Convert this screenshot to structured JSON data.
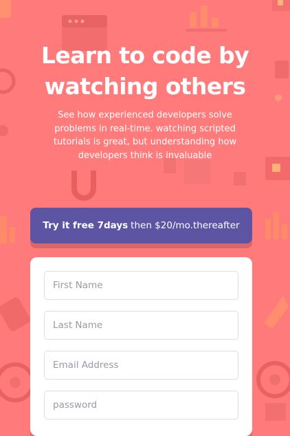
{
  "hero": {
    "title": "Learn to code by watching others",
    "description": "See how experienced developers solve problems in real-time. watching scripted tutorials is great, but understanding how developers think is invaluable"
  },
  "trial": {
    "emphasis": "Try it free 7days",
    "rest": "then $20/mo.thereafter"
  },
  "form": {
    "first_name_placeholder": "First Name",
    "last_name_placeholder": "Last Name",
    "email_placeholder": "Email Address",
    "password_placeholder": "password"
  },
  "colors": {
    "background": "#ff7a7a",
    "banner": "#5e54a4",
    "card": "#ffffff"
  }
}
